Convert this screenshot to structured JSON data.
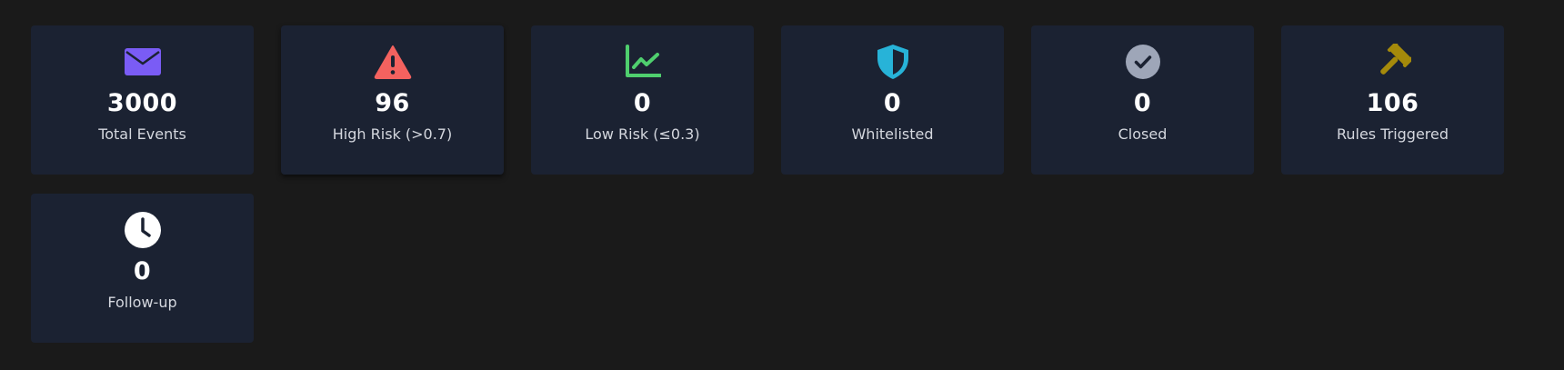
{
  "stats": [
    {
      "label": "Total Events",
      "value": "3000",
      "icon": "envelope-icon",
      "color": "#7a5cf5"
    },
    {
      "label": "High Risk (>0.7)",
      "value": "96",
      "icon": "warning-triangle-icon",
      "color": "#f4625f"
    },
    {
      "label": "Low Risk (≤0.3)",
      "value": "0",
      "icon": "chart-line-icon",
      "color": "#4fcf6e"
    },
    {
      "label": "Whitelisted",
      "value": "0",
      "icon": "shield-icon",
      "color": "#27b3d8"
    },
    {
      "label": "Closed",
      "value": "0",
      "icon": "check-circle-icon",
      "color": "#9ea6b8"
    },
    {
      "label": "Rules Triggered",
      "value": "106",
      "icon": "gavel-icon",
      "color": "#a58a0b"
    },
    {
      "label": "Follow-up",
      "value": "0",
      "icon": "clock-icon",
      "color": "#ffffff"
    }
  ]
}
